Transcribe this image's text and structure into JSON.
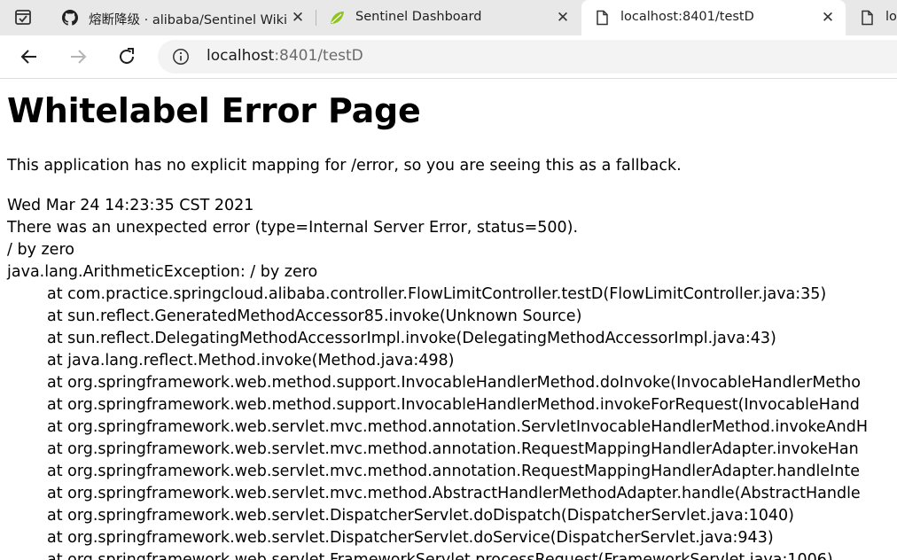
{
  "browser": {
    "tabs": [
      {
        "title": "熔断降级 · alibaba/Sentinel Wiki",
        "icon": "github-icon",
        "active": false
      },
      {
        "title": "Sentinel Dashboard",
        "icon": "sentinel-leaf-icon",
        "active": false
      },
      {
        "title": "localhost:8401/testD",
        "icon": "page-icon",
        "active": true
      },
      {
        "title": "lo",
        "icon": "page-icon",
        "active": false
      }
    ],
    "address": {
      "host": "localhost",
      "rest": ":8401/testD"
    }
  },
  "page": {
    "title": "Whitelabel Error Page",
    "message": "This application has no explicit mapping for /error, so you are seeing this as a fallback.",
    "timestamp": "Wed Mar 24 14:23:35 CST 2021",
    "error_summary": "There was an unexpected error (type=Internal Server Error, status=500).",
    "error_detail": "/ by zero",
    "exception": "java.lang.ArithmeticException: / by zero",
    "stack": [
      "at com.practice.springcloud.alibaba.controller.FlowLimitController.testD(FlowLimitController.java:35)",
      "at sun.reflect.GeneratedMethodAccessor85.invoke(Unknown Source)",
      "at sun.reflect.DelegatingMethodAccessorImpl.invoke(DelegatingMethodAccessorImpl.java:43)",
      "at java.lang.reflect.Method.invoke(Method.java:498)",
      "at org.springframework.web.method.support.InvocableHandlerMethod.doInvoke(InvocableHandlerMetho",
      "at org.springframework.web.method.support.InvocableHandlerMethod.invokeForRequest(InvocableHand",
      "at org.springframework.web.servlet.mvc.method.annotation.ServletInvocableHandlerMethod.invokeAndH",
      "at org.springframework.web.servlet.mvc.method.annotation.RequestMappingHandlerAdapter.invokeHan",
      "at org.springframework.web.servlet.mvc.method.annotation.RequestMappingHandlerAdapter.handleInte",
      "at org.springframework.web.servlet.mvc.method.AbstractHandlerMethodAdapter.handle(AbstractHandle",
      "at org.springframework.web.servlet.DispatcherServlet.doDispatch(DispatcherServlet.java:1040)",
      "at org.springframework.web.servlet.DispatcherServlet.doService(DispatcherServlet.java:943)",
      "at org.springframework.web.servlet.FrameworkServlet.processRequest(FrameworkServlet.java:1006)"
    ]
  }
}
